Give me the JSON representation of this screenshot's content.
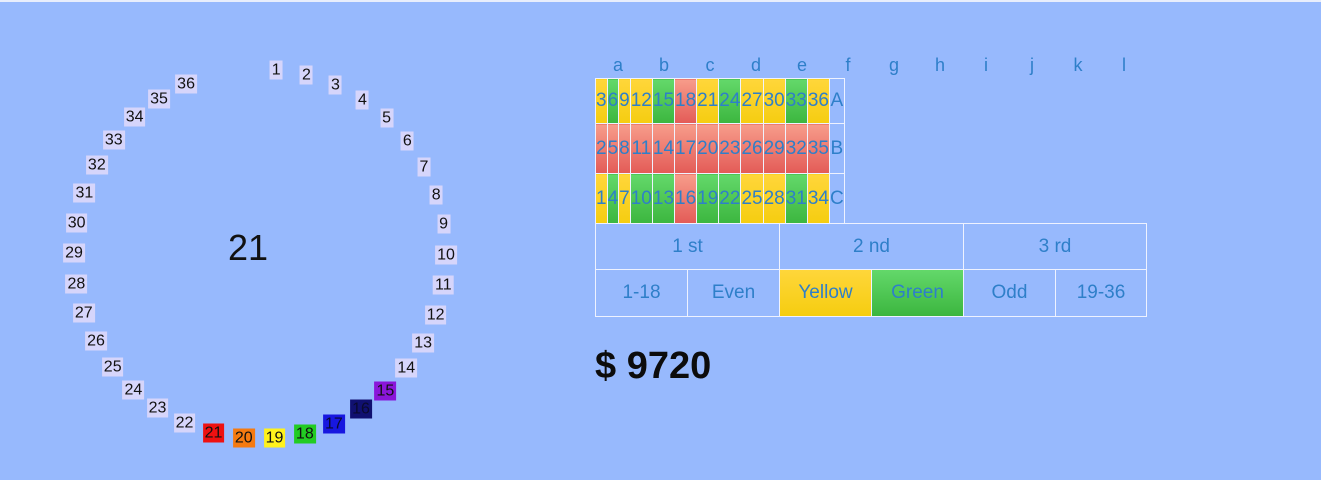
{
  "wheel": {
    "center_value": "21",
    "numbers": [
      "1",
      "2",
      "3",
      "4",
      "5",
      "6",
      "7",
      "8",
      "9",
      "10",
      "11",
      "12",
      "13",
      "14",
      "15",
      "16",
      "17",
      "18",
      "19",
      "20",
      "21",
      "22",
      "23",
      "24",
      "25",
      "26",
      "27",
      "28",
      "29",
      "30",
      "31",
      "32",
      "33",
      "34",
      "35",
      "36"
    ],
    "highlight_colors": {
      "21": "#ee1111",
      "20": "#f57a10",
      "19": "#fff21c",
      "18": "#22cc22",
      "17": "#1717e0",
      "16": "#101070",
      "15": "#8a16d9"
    }
  },
  "board": {
    "column_letters": [
      "a",
      "b",
      "c",
      "d",
      "e",
      "f",
      "g",
      "h",
      "i",
      "j",
      "k",
      "l"
    ],
    "rows": [
      {
        "label": "A",
        "cells": [
          {
            "n": "3",
            "c": "yellow"
          },
          {
            "n": "6",
            "c": "green"
          },
          {
            "n": "9",
            "c": "yellow"
          },
          {
            "n": "12",
            "c": "yellow"
          },
          {
            "n": "15",
            "c": "green"
          },
          {
            "n": "18",
            "c": "red"
          },
          {
            "n": "21",
            "c": "yellow"
          },
          {
            "n": "24",
            "c": "green"
          },
          {
            "n": "27",
            "c": "yellow"
          },
          {
            "n": "30",
            "c": "yellow"
          },
          {
            "n": "33",
            "c": "green"
          },
          {
            "n": "36",
            "c": "yellow"
          }
        ]
      },
      {
        "label": "B",
        "cells": [
          {
            "n": "2",
            "c": "red"
          },
          {
            "n": "5",
            "c": "red"
          },
          {
            "n": "8",
            "c": "red"
          },
          {
            "n": "11",
            "c": "red"
          },
          {
            "n": "14",
            "c": "red"
          },
          {
            "n": "17",
            "c": "red"
          },
          {
            "n": "20",
            "c": "red"
          },
          {
            "n": "23",
            "c": "red"
          },
          {
            "n": "26",
            "c": "red"
          },
          {
            "n": "29",
            "c": "red"
          },
          {
            "n": "32",
            "c": "red"
          },
          {
            "n": "35",
            "c": "red"
          }
        ]
      },
      {
        "label": "C",
        "cells": [
          {
            "n": "1",
            "c": "yellow"
          },
          {
            "n": "4",
            "c": "green"
          },
          {
            "n": "7",
            "c": "yellow"
          },
          {
            "n": "10",
            "c": "green"
          },
          {
            "n": "13",
            "c": "green"
          },
          {
            "n": "16",
            "c": "red"
          },
          {
            "n": "19",
            "c": "green"
          },
          {
            "n": "22",
            "c": "green"
          },
          {
            "n": "25",
            "c": "yellow"
          },
          {
            "n": "28",
            "c": "yellow"
          },
          {
            "n": "31",
            "c": "green"
          },
          {
            "n": "34",
            "c": "yellow"
          }
        ]
      }
    ],
    "dozens": [
      "1 st",
      "2 nd",
      "3 rd"
    ],
    "outside_bets": [
      {
        "label": "1-18",
        "c": "none"
      },
      {
        "label": "Even",
        "c": "none"
      },
      {
        "label": "Yellow",
        "c": "yellow"
      },
      {
        "label": "Green",
        "c": "green"
      },
      {
        "label": "Odd",
        "c": "none"
      },
      {
        "label": "19-36",
        "c": "none"
      }
    ]
  },
  "balance": "$ 9720"
}
